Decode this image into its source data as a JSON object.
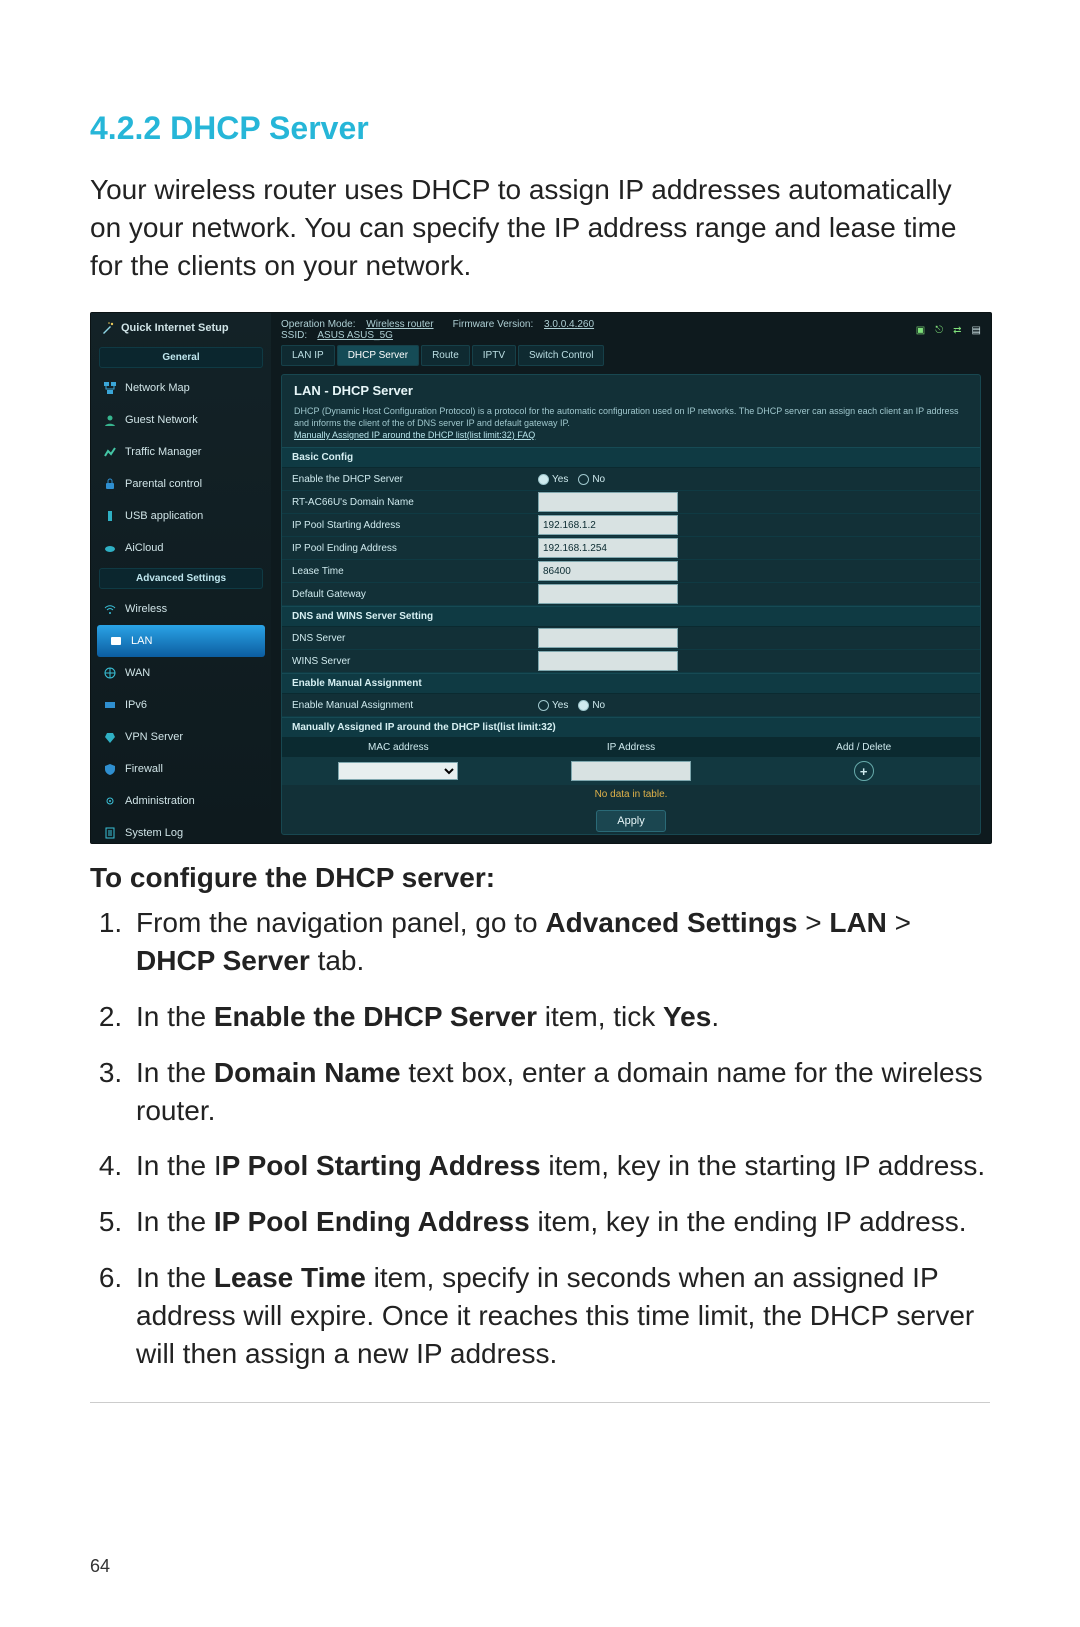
{
  "doc": {
    "section_number": "4.2.2",
    "section_title": "DHCP Server",
    "intro": "Your wireless router uses DHCP to assign IP addresses automatically on your network. You can specify the IP address range and lease time for the clients on your network.",
    "configure_heading": "To configure the DHCP server:",
    "steps": {
      "s1a": "From the navigation panel, go to ",
      "s1b": "Advanced Settings",
      "s1c": " > ",
      "s1d": "LAN",
      "s1e": " > ",
      "s1f": "DHCP Server",
      "s1g": " tab.",
      "s2a": "In the ",
      "s2b": "Enable the DHCP Server",
      "s2c": " item, tick ",
      "s2d": "Yes",
      "s2e": ".",
      "s3a": "In the ",
      "s3b": "Domain Name",
      "s3c": " text box, enter a domain name for the wireless router.",
      "s4a": "In the I",
      "s4b": "P Pool Starting Address",
      "s4c": " item, key in the starting IP address.",
      "s5a": "In the ",
      "s5b": "IP Pool Ending Address",
      "s5c": " item, key in the ending IP address.",
      "s6a": "In the ",
      "s6b": "Lease Time",
      "s6c": " item, specify in seconds when an assigned IP address will expire. Once it reaches this time limit, the DHCP server will then assign a new IP address."
    },
    "page_number": "64"
  },
  "ui": {
    "quick_internet_setup": "Quick Internet Setup",
    "top": {
      "op_mode_label": "Operation Mode:",
      "op_mode_value": "Wireless router",
      "fw_label": "Firmware Version:",
      "fw_value": "3.0.0.4.260",
      "ssid_label": "SSID:",
      "ssid_value": "ASUS ASUS_5G"
    },
    "groups": {
      "general": "General",
      "advanced": "Advanced Settings"
    },
    "nav": {
      "network_map": "Network Map",
      "guest_network": "Guest Network",
      "traffic_manager": "Traffic Manager",
      "parental_control": "Parental control",
      "usb_application": "USB application",
      "aicloud": "AiCloud",
      "wireless": "Wireless",
      "lan": "LAN",
      "wan": "WAN",
      "ipv6": "IPv6",
      "vpn_server": "VPN Server",
      "firewall": "Firewall",
      "administration": "Administration",
      "system_log": "System Log"
    },
    "tabs": {
      "lan_ip": "LAN IP",
      "dhcp_server": "DHCP Server",
      "route": "Route",
      "iptv": "IPTV",
      "switch_control": "Switch Control"
    },
    "panel": {
      "title": "LAN - DHCP Server",
      "desc1": "DHCP (Dynamic Host Configuration Protocol) is a protocol for the automatic configuration used on IP networks. The DHCP server can assign each client an IP address and informs the client of the of DNS server IP and default gateway IP.",
      "faq_link": "Manually Assigned IP around the DHCP list(list limit:32) FAQ",
      "sect_basic": "Basic Config",
      "enable_label": "Enable the DHCP Server",
      "yes": "Yes",
      "no": "No",
      "domain_label": "RT-AC66U's Domain Name",
      "ip_start_label": "IP Pool Starting Address",
      "ip_start_value": "192.168.1.2",
      "ip_end_label": "IP Pool Ending Address",
      "ip_end_value": "192.168.1.254",
      "lease_label": "Lease Time",
      "lease_value": "86400",
      "gateway_label": "Default Gateway",
      "sect_dns": "DNS and WINS Server Setting",
      "dns_label": "DNS Server",
      "wins_label": "WINS Server",
      "sect_manual": "Enable Manual Assignment",
      "manual_label": "Enable Manual Assignment",
      "sect_list": "Manually Assigned IP around the DHCP list(list limit:32)",
      "col_mac": "MAC address",
      "col_ip": "IP Address",
      "col_add": "Add / Delete",
      "no_data": "No data in table.",
      "apply": "Apply"
    }
  }
}
